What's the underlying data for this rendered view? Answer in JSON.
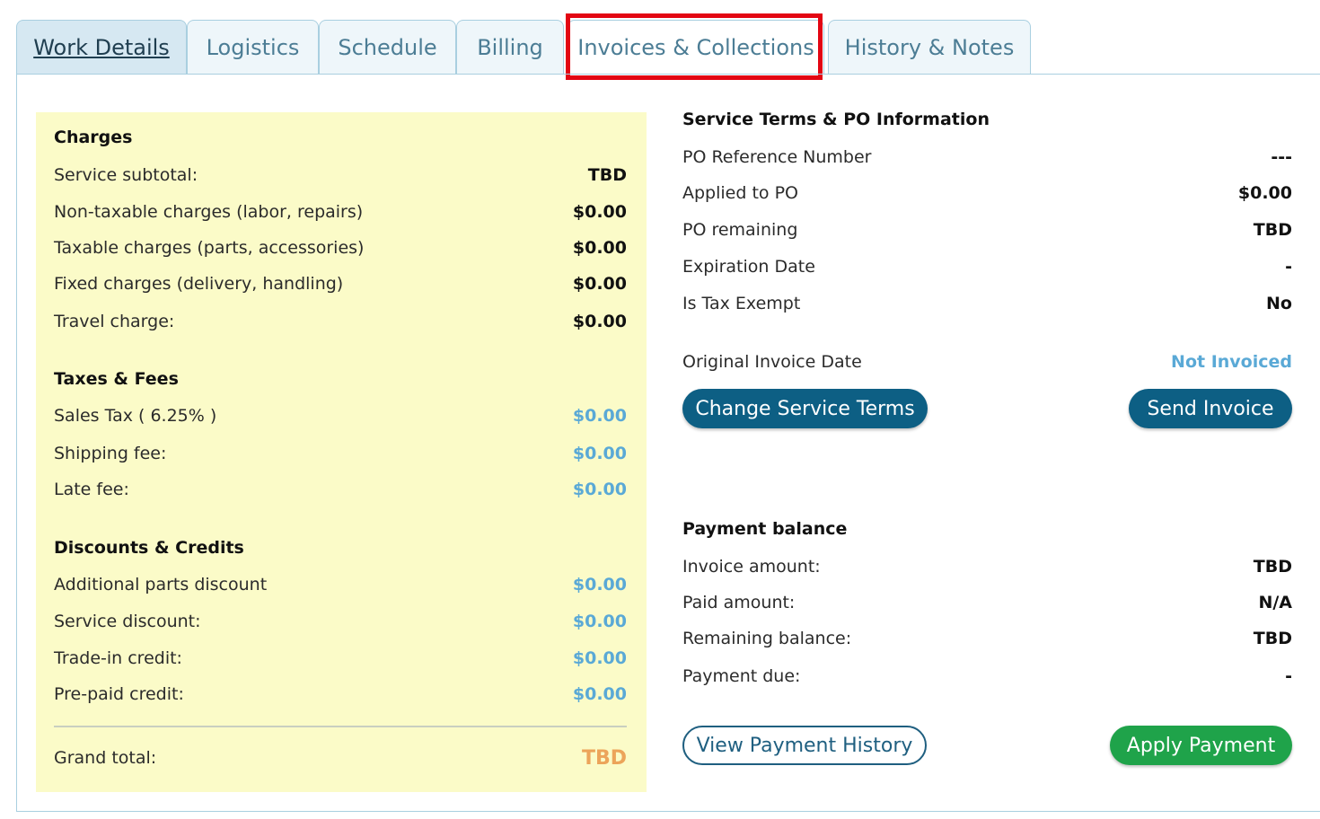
{
  "tabs": [
    {
      "label": "Work Details"
    },
    {
      "label": "Logistics"
    },
    {
      "label": "Schedule"
    },
    {
      "label": "Billing"
    },
    {
      "label": "Invoices & Collections"
    },
    {
      "label": "History & Notes"
    }
  ],
  "charges": {
    "title": "Charges",
    "service_subtotal": {
      "label": "Service subtotal:",
      "value": "TBD"
    },
    "non_taxable": {
      "label": "Non-taxable charges (labor, repairs)",
      "value": "$0.00"
    },
    "taxable": {
      "label": "Taxable charges (parts, accessories)",
      "value": "$0.00"
    },
    "fixed": {
      "label": "Fixed charges (delivery, handling)",
      "value": "$0.00"
    },
    "travel": {
      "label": "Travel charge:",
      "value": "$0.00"
    }
  },
  "taxes": {
    "title": "Taxes & Fees",
    "sales_tax": {
      "label": "Sales Tax ( 6.25% )",
      "value": "$0.00"
    },
    "shipping": {
      "label": "Shipping fee:",
      "value": "$0.00"
    },
    "late": {
      "label": "Late fee:",
      "value": "$0.00"
    }
  },
  "discounts": {
    "title": "Discounts & Credits",
    "parts_discount": {
      "label": "Additional parts discount",
      "value": "$0.00"
    },
    "service_discount": {
      "label": "Service discount:",
      "value": "$0.00"
    },
    "trade_in": {
      "label": "Trade-in credit:",
      "value": "$0.00"
    },
    "prepaid": {
      "label": "Pre-paid credit:",
      "value": "$0.00"
    }
  },
  "grand_total": {
    "label": "Grand total:",
    "value": "TBD"
  },
  "service_terms": {
    "title": "Service Terms & PO Information",
    "po_ref": {
      "label": "PO Reference Number",
      "value": "---"
    },
    "applied": {
      "label": "Applied to PO",
      "value": "$0.00"
    },
    "remaining": {
      "label": "PO remaining",
      "value": "TBD"
    },
    "expiration": {
      "label": "Expiration Date",
      "value": "-"
    },
    "tax_exempt": {
      "label": "Is Tax Exempt",
      "value": "No"
    },
    "invoice_date": {
      "label": "Original Invoice Date",
      "value": "Not Invoiced"
    },
    "change_terms_label": "Change Service Terms",
    "send_invoice_label": "Send Invoice"
  },
  "payment": {
    "title": "Payment balance",
    "invoice_amount": {
      "label": "Invoice amount:",
      "value": "TBD"
    },
    "paid_amount": {
      "label": "Paid amount:",
      "value": "N/A"
    },
    "remaining_balance": {
      "label": "Remaining balance:",
      "value": "TBD"
    },
    "payment_due": {
      "label": "Payment due:",
      "value": "-"
    },
    "view_history_label": "View Payment History",
    "apply_payment_label": "Apply Payment"
  },
  "colors": {
    "accent": "#0d5f84",
    "highlight": "#e30613",
    "charges_bg": "#fbfbc8",
    "success": "#1fa34a",
    "link": "#5aa9d6",
    "total": "#eca45a"
  }
}
